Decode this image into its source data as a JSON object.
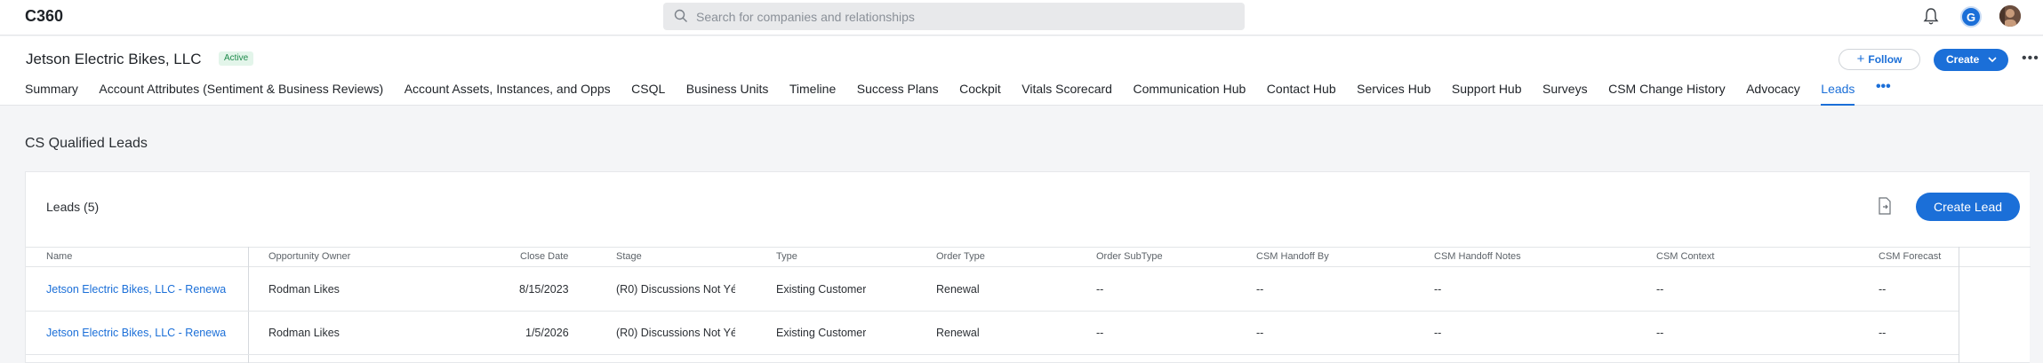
{
  "app": {
    "title": "C360"
  },
  "search": {
    "placeholder": "Search for companies and relationships"
  },
  "header": {
    "company_name": "Jetson Electric Bikes, LLC",
    "status_badge": "Active",
    "follow_label": "Follow",
    "create_label": "Create"
  },
  "tabs": [
    {
      "label": "Summary"
    },
    {
      "label": "Account Attributes (Sentiment & Business Reviews)"
    },
    {
      "label": "Account Assets, Instances, and Opps"
    },
    {
      "label": "CSQL"
    },
    {
      "label": "Business Units"
    },
    {
      "label": "Timeline"
    },
    {
      "label": "Success Plans"
    },
    {
      "label": "Cockpit"
    },
    {
      "label": "Vitals Scorecard"
    },
    {
      "label": "Communication Hub"
    },
    {
      "label": "Contact Hub"
    },
    {
      "label": "Services Hub"
    },
    {
      "label": "Support Hub"
    },
    {
      "label": "Surveys"
    },
    {
      "label": "CSM Change History"
    },
    {
      "label": "Advocacy"
    },
    {
      "label": "Leads",
      "active": true
    }
  ],
  "section": {
    "title": "CS Qualified Leads"
  },
  "leads": {
    "title": "Leads (5)",
    "create_button": "Create Lead",
    "columns": [
      "Name",
      "Opportunity Owner",
      "Close Date",
      "Stage",
      "Type",
      "Order Type",
      "Order SubType",
      "CSM Handoff By",
      "CSM Handoff Notes",
      "CSM Context",
      "CSM Forecast"
    ],
    "rows": [
      {
        "name": "Jetson Electric Bikes, LLC - Renewa",
        "owner": "Rodman Likes",
        "close_date": "8/15/2023",
        "stage": "(R0) Discussions Not Yé",
        "type": "Existing Customer",
        "order_type": "Renewal",
        "order_subtype": "--",
        "handoff_by": "--",
        "handoff_notes": "--",
        "context": "--",
        "forecast": "--"
      },
      {
        "name": "Jetson Electric Bikes, LLC - Renewa",
        "owner": "Rodman Likes",
        "close_date": "1/5/2026",
        "stage": "(R0) Discussions Not Yé",
        "type": "Existing Customer",
        "order_type": "Renewal",
        "order_subtype": "--",
        "handoff_by": "--",
        "handoff_notes": "--",
        "context": "--",
        "forecast": "--"
      }
    ]
  },
  "colors": {
    "accent": "#1b6fd8",
    "active_badge_bg": "#e3f5ea",
    "active_badge_text": "#1e8a4b"
  },
  "icons": [
    "search-icon",
    "bell-icon",
    "user-avatar-g",
    "user-avatar-photo",
    "plus-icon",
    "chevron-down-icon",
    "more-icon",
    "export-icon"
  ]
}
